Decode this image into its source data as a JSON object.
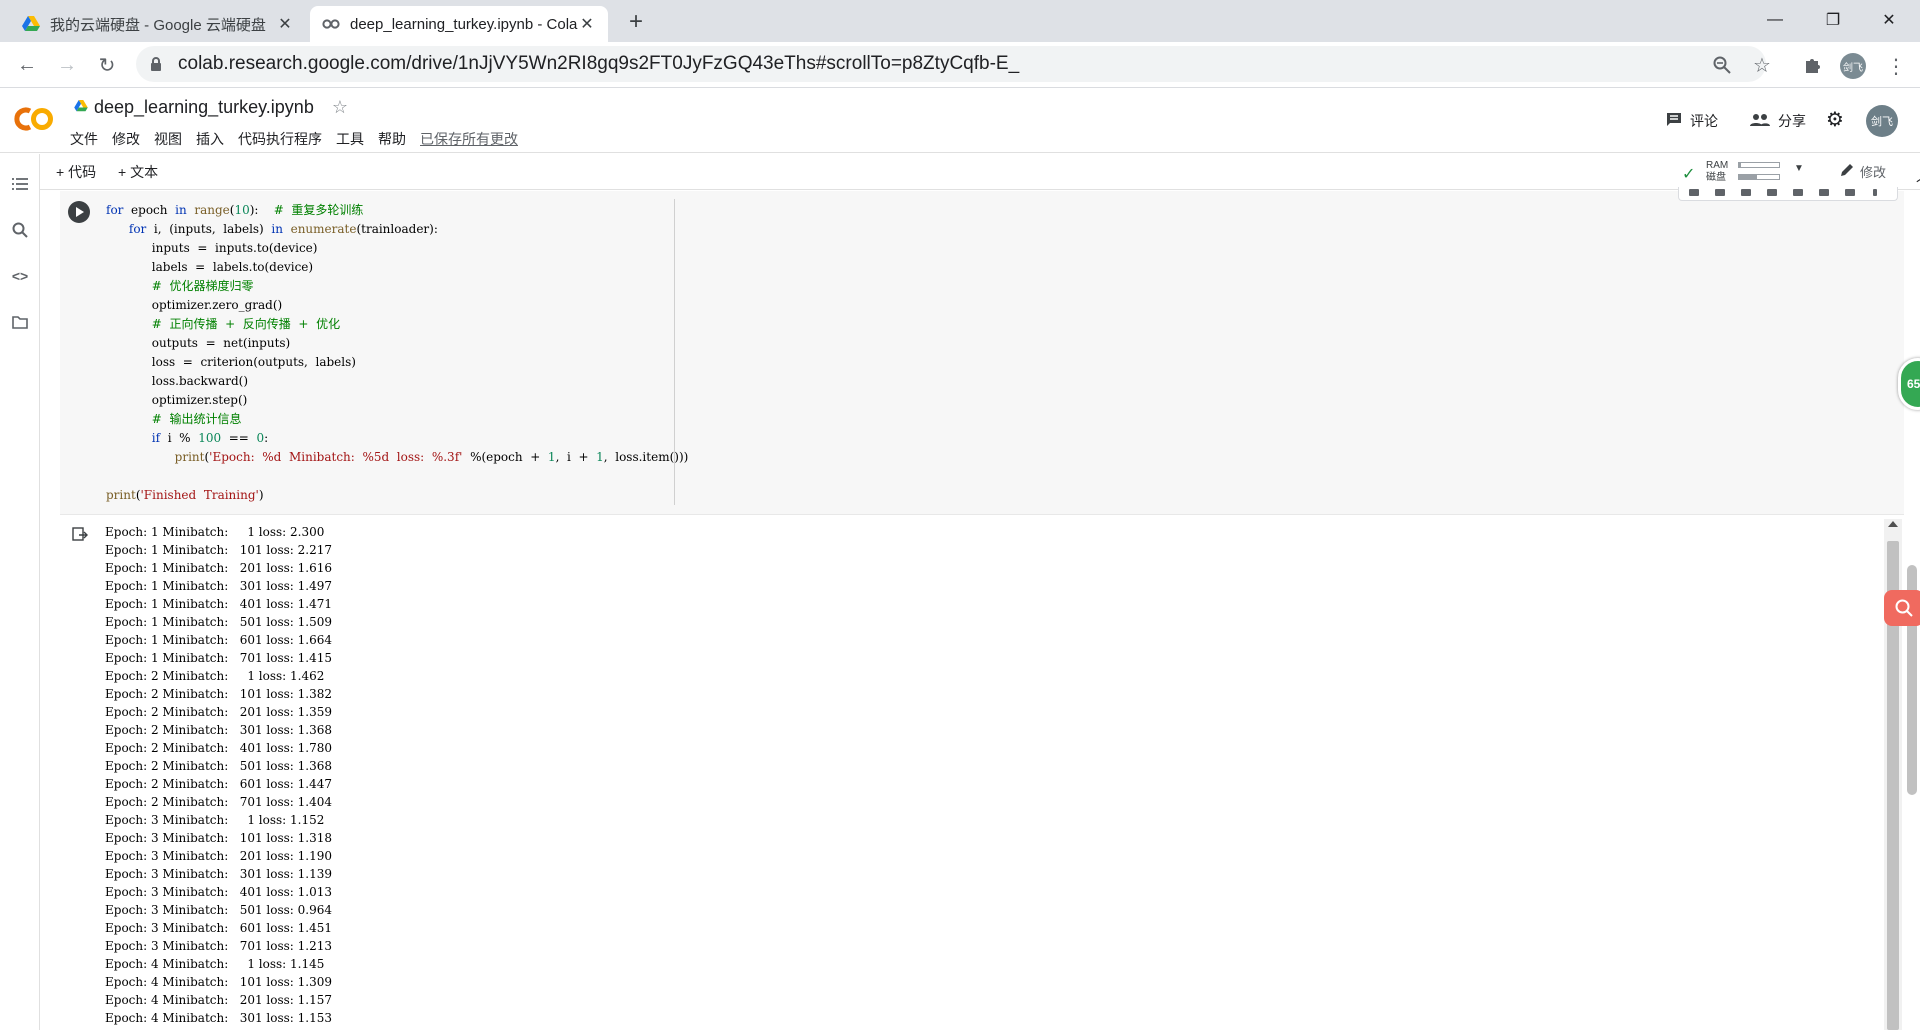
{
  "browser": {
    "tabs": [
      {
        "title": "我的云端硬盘 - Google 云端硬盘",
        "active": false
      },
      {
        "title": "deep_learning_turkey.ipynb - Colaboratory",
        "active": true
      }
    ],
    "url": "colab.research.google.com/drive/1nJjVY5Wn2RI8gq9s2FT0JyFzGQ43eThs#scrollTo=p8ZtyCqfb-E_",
    "profile_label": "剑飞"
  },
  "colab": {
    "logo_text": "CO",
    "notebook_title": "deep_learning_turkey.ipynb",
    "menus": [
      "文件",
      "修改",
      "视图",
      "插入",
      "代码执行程序",
      "工具",
      "帮助"
    ],
    "saved_status": "已保存所有更改",
    "comment_label": "评论",
    "share_label": "分享",
    "avatar_label": "剑飞"
  },
  "toolbar": {
    "add_code": "+ 代码",
    "add_text": "+ 文本",
    "ram_label": "RAM",
    "disk_label": "磁盘",
    "ram_usage": 0.05,
    "disk_usage": 0.45,
    "edit_label": "修改"
  },
  "code_lines": [
    "for  epoch  in  range(10):    #  重复多轮训练",
    "      for  i,  (inputs,  labels)  in  enumerate(trainloader):",
    "            inputs  =  inputs.to(device)",
    "            labels  =  labels.to(device)",
    "            #  优化器梯度归零",
    "            optimizer.zero_grad()",
    "            #  正向传播  +  反向传播  +  优化",
    "            outputs  =  net(inputs)",
    "            loss  =  criterion(outputs,  labels)",
    "            loss.backward()",
    "            optimizer.step()",
    "            #  输出统计信息",
    "            if  i  %  100  ==  0:",
    "                  print('Epoch:  %d  Minibatch:  %5d  loss:  %.3f'  %(epoch  +  1,  i  +  1,  loss.item()))",
    "",
    "print('Finished  Training')"
  ],
  "output_lines": [
    "Epoch: 1 Minibatch:     1 loss: 2.300",
    "Epoch: 1 Minibatch:   101 loss: 2.217",
    "Epoch: 1 Minibatch:   201 loss: 1.616",
    "Epoch: 1 Minibatch:   301 loss: 1.497",
    "Epoch: 1 Minibatch:   401 loss: 1.471",
    "Epoch: 1 Minibatch:   501 loss: 1.509",
    "Epoch: 1 Minibatch:   601 loss: 1.664",
    "Epoch: 1 Minibatch:   701 loss: 1.415",
    "Epoch: 2 Minibatch:     1 loss: 1.462",
    "Epoch: 2 Minibatch:   101 loss: 1.382",
    "Epoch: 2 Minibatch:   201 loss: 1.359",
    "Epoch: 2 Minibatch:   301 loss: 1.368",
    "Epoch: 2 Minibatch:   401 loss: 1.780",
    "Epoch: 2 Minibatch:   501 loss: 1.368",
    "Epoch: 2 Minibatch:   601 loss: 1.447",
    "Epoch: 2 Minibatch:   701 loss: 1.404",
    "Epoch: 3 Minibatch:     1 loss: 1.152",
    "Epoch: 3 Minibatch:   101 loss: 1.318",
    "Epoch: 3 Minibatch:   201 loss: 1.190",
    "Epoch: 3 Minibatch:   301 loss: 1.139",
    "Epoch: 3 Minibatch:   401 loss: 1.013",
    "Epoch: 3 Minibatch:   501 loss: 0.964",
    "Epoch: 3 Minibatch:   601 loss: 1.451",
    "Epoch: 3 Minibatch:   701 loss: 1.213",
    "Epoch: 4 Minibatch:     1 loss: 1.145",
    "Epoch: 4 Minibatch:   101 loss: 1.309",
    "Epoch: 4 Minibatch:   201 loss: 1.157",
    "Epoch: 4 Minibatch:   301 loss: 1.153"
  ],
  "floating_badge": "65",
  "colors": {
    "colab_orange": "#f9ab00",
    "run_button": "#3c4043",
    "keyword": "#0033b3",
    "comment": "#008000"
  }
}
